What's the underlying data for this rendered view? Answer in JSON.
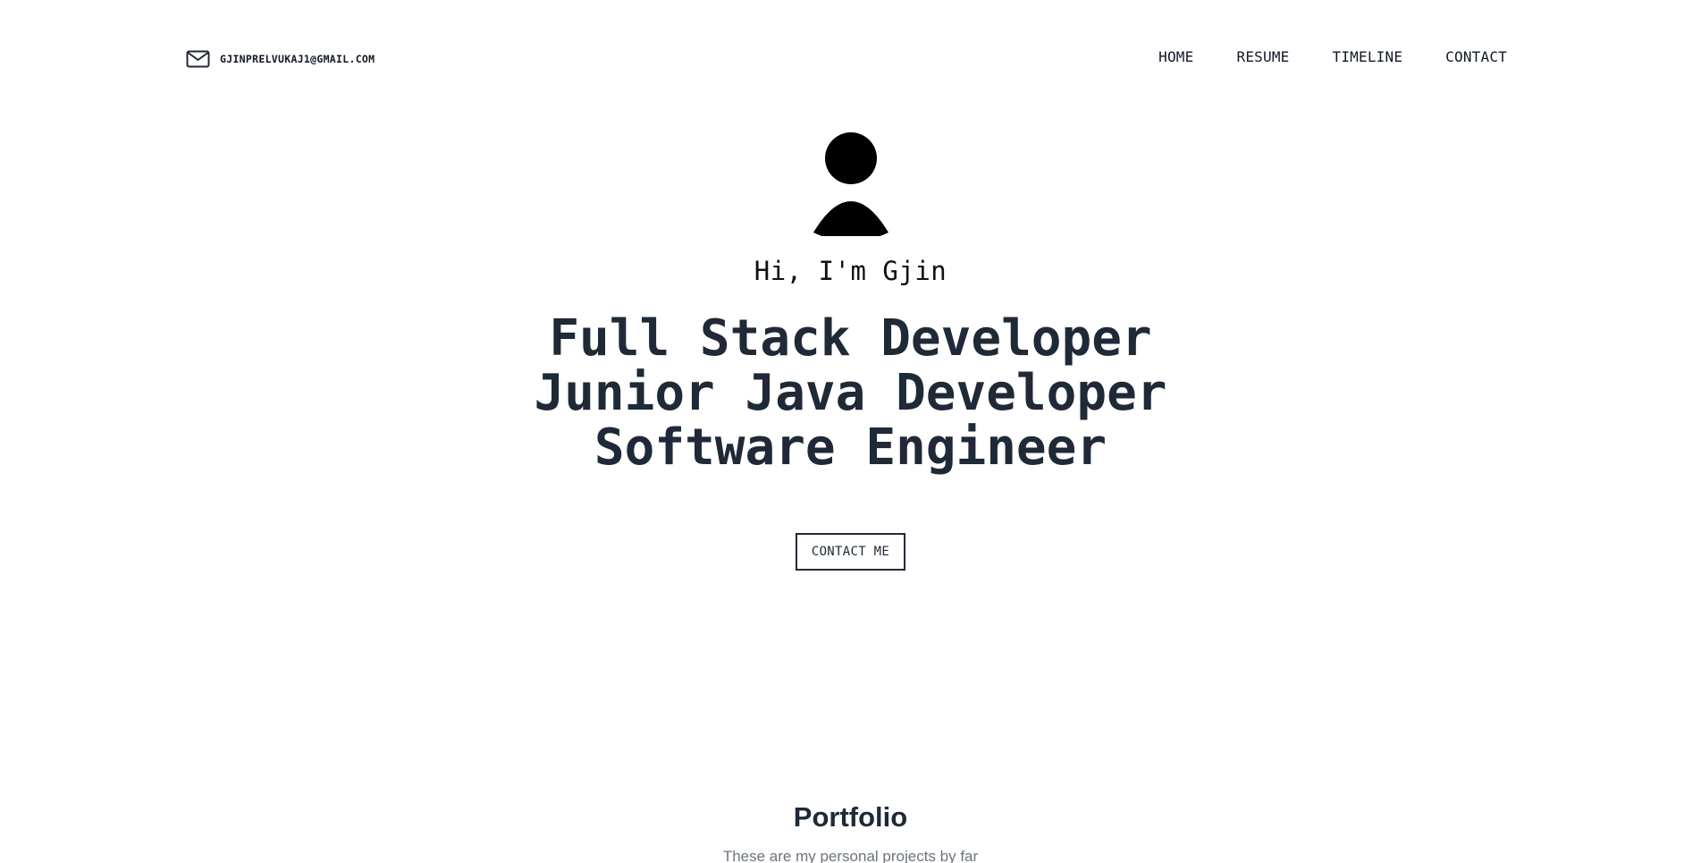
{
  "header": {
    "email": "GJINPRELVUKAJ1@GMAIL.COM",
    "email_icon": "mail-icon",
    "nav": [
      {
        "label": "HOME"
      },
      {
        "label": "RESUME"
      },
      {
        "label": "TIMELINE"
      },
      {
        "label": "CONTACT"
      }
    ]
  },
  "hero": {
    "avatar_icon": "user-avatar-icon",
    "greeting": "Hi, I'm Gjin",
    "roles": [
      "Full Stack Developer",
      "Junior Java Developer",
      "Software Engineer"
    ],
    "cta_label": "CONTACT ME"
  },
  "portfolio": {
    "title": "Portfolio",
    "subtitle": "These are my personal projects by far"
  },
  "colors": {
    "text_dark": "#1f2937",
    "text_muted": "#6b7280",
    "background": "#ffffff"
  }
}
